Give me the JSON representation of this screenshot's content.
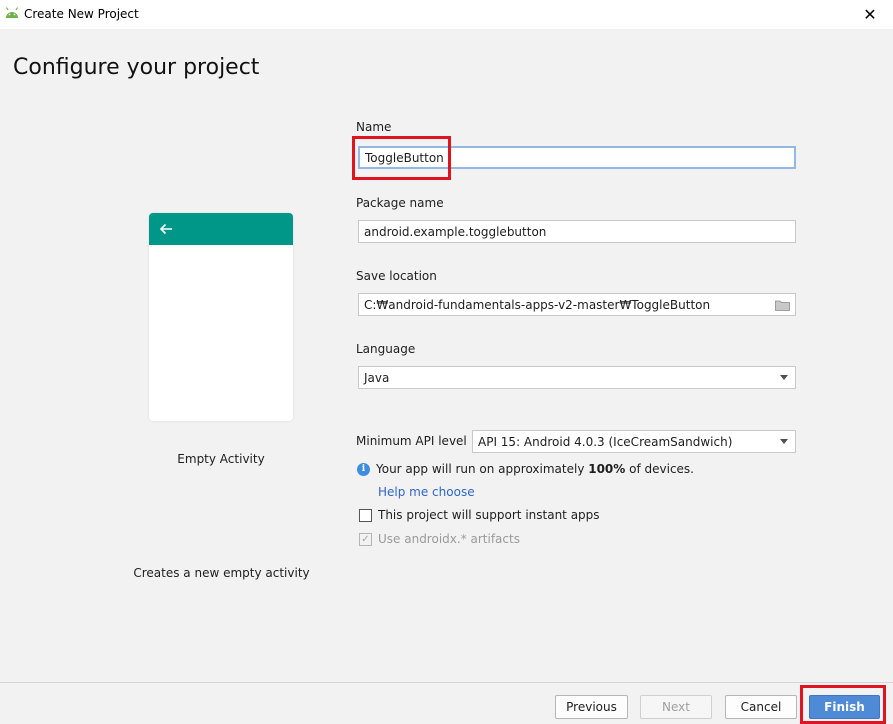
{
  "window": {
    "title": "Create New Project",
    "close_glyph": "✕",
    "app_icon": "android-icon"
  },
  "page": {
    "heading": "Configure your project"
  },
  "template": {
    "name": "Empty Activity",
    "description": "Creates a new empty activity",
    "back_icon": "arrow-left-icon",
    "accent_color": "#009688"
  },
  "form": {
    "name_label": "Name",
    "name_value": "ToggleButton",
    "package_label": "Package name",
    "package_value": "android.example.togglebutton",
    "save_label": "Save location",
    "save_value": "C:₩android-fundamentals-apps-v2-master₩ToggleButton",
    "language_label": "Language",
    "language_value": "Java",
    "min_api_label": "Minimum API level",
    "min_api_value": "API 15: Android 4.0.3 (IceCreamSandwich)",
    "info_prefix": "Your app will run on approximately ",
    "info_percent": "100%",
    "info_suffix": " of devices.",
    "help_link": "Help me choose",
    "instant_apps_label": "This project will support instant apps",
    "instant_apps_checked": false,
    "androidx_label": "Use androidx.* artifacts",
    "androidx_checked": true
  },
  "buttons": {
    "previous": "Previous",
    "next": "Next",
    "cancel": "Cancel",
    "finish": "Finish"
  },
  "colors": {
    "highlight": "#e0141e",
    "link": "#2f65ca",
    "primary_button": "#4e8ad6"
  }
}
